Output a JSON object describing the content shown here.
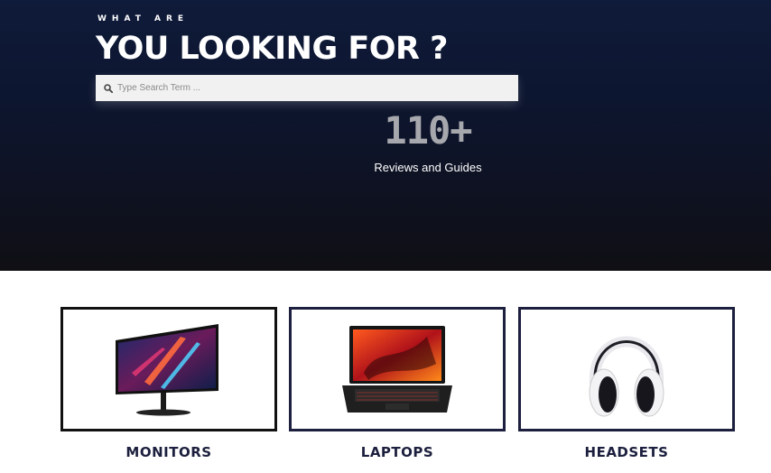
{
  "hero": {
    "eyebrow": "WHAT ARE",
    "headline": "YOU LOOKING FOR ?",
    "search": {
      "placeholder": "Type Search Term ..."
    },
    "stat": {
      "number": "110+",
      "label": "Reviews and Guides"
    }
  },
  "categories": [
    {
      "label": "MONITORS",
      "icon": "monitor-image"
    },
    {
      "label": "LAPTOPS",
      "icon": "laptop-image"
    },
    {
      "label": "HEADSETS",
      "icon": "headset-image"
    }
  ],
  "colors": {
    "hero_top": "#0f1b3a",
    "hero_bottom": "#0f0f14",
    "card_border": "#1c1f3d",
    "stat_number": "#a7a8ad"
  }
}
